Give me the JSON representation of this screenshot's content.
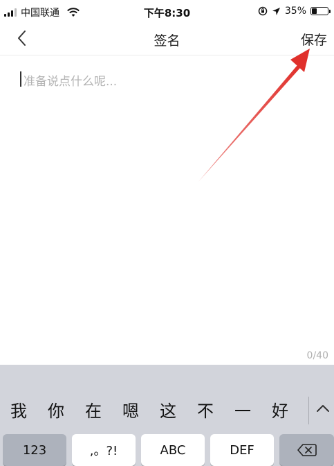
{
  "status_bar": {
    "carrier": "中国联通",
    "time": "下午8:30",
    "battery": "35%",
    "battery_level": 0.35,
    "icons": [
      "signal-icon",
      "wifi-icon",
      "orientation-lock-icon",
      "location-arrow-icon",
      "battery-icon"
    ]
  },
  "nav": {
    "back_icon": "chevron-left-icon",
    "title": "签名",
    "save_label": "保存"
  },
  "editor": {
    "value": "",
    "placeholder": "准备说点什么呢...",
    "counter": "0/40"
  },
  "annotation": {
    "type": "red-arrow",
    "color": "#e0302b",
    "points_to": "save-button"
  },
  "keyboard": {
    "candidates": [
      "我",
      "你",
      "在",
      "嗯",
      "这",
      "不",
      "一",
      "好"
    ],
    "expand_icon": "chevron-up-icon",
    "keys": {
      "numbers": "123",
      "punctuation": ",。?!",
      "abc": "ABC",
      "def": "DEF",
      "delete_icon": "delete-icon"
    }
  },
  "colors": {
    "keyboard_bg": "#d2d4db",
    "key_bg": "#ffffff",
    "key_dark_bg": "#adb2bc",
    "placeholder": "#b3b3b3",
    "arrow": "#e0302b"
  }
}
